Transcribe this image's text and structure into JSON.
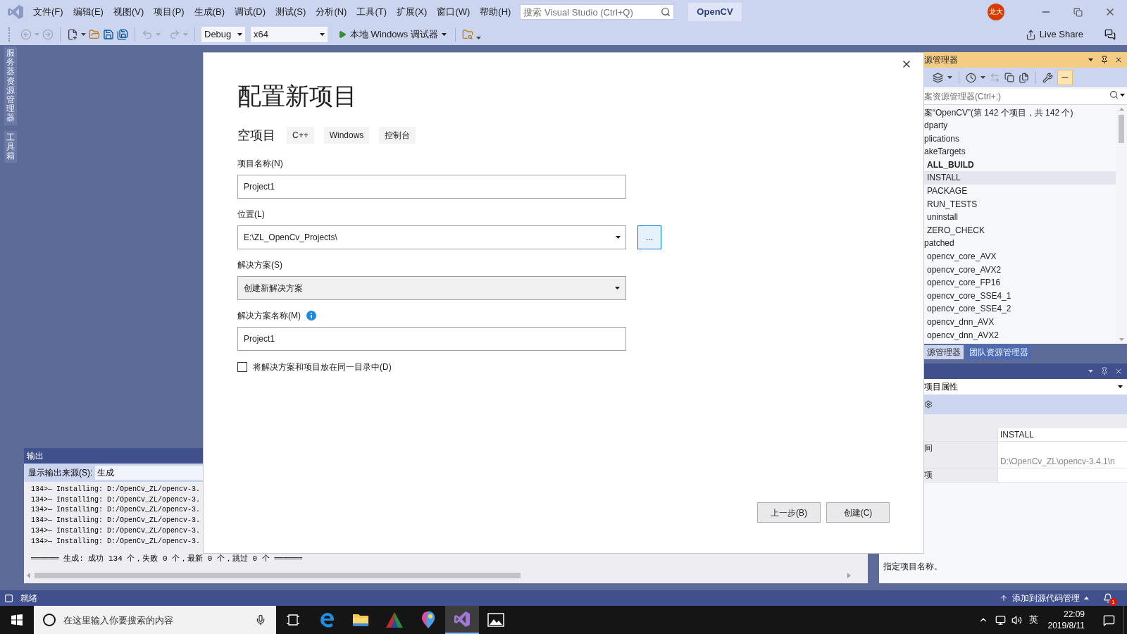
{
  "menu_bar": {
    "menus": [
      "文件(F)",
      "编辑(E)",
      "视图(V)",
      "项目(P)",
      "生成(B)",
      "调试(D)",
      "测试(S)",
      "分析(N)",
      "工具(T)",
      "扩展(X)",
      "窗口(W)",
      "帮助(H)"
    ],
    "search_placeholder": "搜索 Visual Studio (Ctrl+Q)",
    "solution": "OpenCV",
    "avatar": "龙大"
  },
  "toolbar": {
    "configuration": "Debug",
    "platform": "x64",
    "debugger": "本地 Windows 调试器",
    "live_share": "Live Share"
  },
  "side_tabs": [
    "服务器资源管理器",
    "工具箱"
  ],
  "dialog": {
    "title": "配置新项目",
    "template": "空项目",
    "tags": [
      "C++",
      "Windows",
      "控制台"
    ],
    "fields": [
      {
        "kind": "text",
        "label": "项目名称(N)",
        "value": "Project1",
        "info": false
      },
      {
        "kind": "combo",
        "label": "位置(L)",
        "value": "E:\\ZL_OpenCv_Projects\\",
        "browse": "...",
        "info": false
      },
      {
        "kind": "select",
        "label": "解决方案(S)",
        "value": "创建新解决方案",
        "info": false
      },
      {
        "kind": "text",
        "label": "解决方案名称(M)",
        "value": "Project1",
        "info": true
      }
    ],
    "checkbox": {
      "label": "将解决方案和项目放在同一目录中(D)",
      "checked": false
    },
    "buttons": [
      "上一步(B)",
      "创建(C)"
    ]
  },
  "solution_explorer": {
    "title": "源管理器",
    "search_placeholder": "案资源管理器(Ctrl+;)",
    "tree": [
      {
        "label": "案“OpenCV”(第 142 个项目，共 142 个)",
        "selected": false,
        "startup": false,
        "children": [
          {
            "label": "dparty",
            "selected": false,
            "startup": false
          },
          {
            "label": "plications",
            "selected": false,
            "startup": false
          },
          {
            "label": "akeTargets",
            "selected": false,
            "startup": false,
            "children": [
              {
                "label": "ALL_BUILD",
                "selected": false,
                "startup": true
              },
              {
                "label": "INSTALL",
                "selected": true,
                "startup": false
              },
              {
                "label": "PACKAGE",
                "selected": false,
                "startup": false
              },
              {
                "label": "RUN_TESTS",
                "selected": false,
                "startup": false
              },
              {
                "label": "uninstall",
                "selected": false,
                "startup": false
              },
              {
                "label": "ZERO_CHECK",
                "selected": false,
                "startup": false
              }
            ]
          },
          {
            "label": "patched",
            "selected": false,
            "startup": false,
            "children": [
              {
                "label": "opencv_core_AVX",
                "selected": false,
                "startup": false
              },
              {
                "label": "opencv_core_AVX2",
                "selected": false,
                "startup": false
              },
              {
                "label": "opencv_core_FP16",
                "selected": false,
                "startup": false
              },
              {
                "label": "opencv_core_SSE4_1",
                "selected": false,
                "startup": false
              },
              {
                "label": "opencv_core_SSE4_2",
                "selected": false,
                "startup": false
              },
              {
                "label": "opencv_dnn_AVX",
                "selected": false,
                "startup": false
              },
              {
                "label": "opencv_dnn_AVX2",
                "selected": false,
                "startup": false
              }
            ]
          }
        ]
      }
    ],
    "tabs": [
      {
        "label": "源管理器",
        "selected": true
      },
      {
        "label": "团队资源管理器",
        "selected": false
      }
    ]
  },
  "properties": {
    "object": "项目属性",
    "rows": [
      {
        "value": "INSTALL",
        "readonly": false
      },
      {
        "name": "间",
        "readonly": false
      },
      {
        "value": "D:\\OpenCv_ZL\\opencv-3.4.1\\n",
        "readonly": true
      },
      {
        "name": "项",
        "readonly": false
      }
    ],
    "description": "指定项目名称。"
  },
  "output": {
    "title": "输出",
    "source_label": "显示输出来源(S):",
    "source": "生成",
    "lines": [
      "134>— Installing: D:/OpenCv_ZL/opencv-3.",
      "134>— Installing: D:/OpenCv_ZL/opencv-3.",
      "134>— Installing: D:/OpenCv_ZL/opencv-3.",
      "134>— Installing: D:/OpenCv_ZL/opencv-3.",
      "134>— Installing: D:/OpenCv_ZL/opencv-3.",
      "134>— Installing: D:/OpenCv_ZL/opencv-3."
    ],
    "summary": "══════ 生成: 成功 134 个，失败 0 个，最新 0 个，跳过 0 个 ══════"
  },
  "status_bar": {
    "status": "就绪",
    "source_control": "添加到源代码管理",
    "notification_count": "1"
  },
  "taskbar": {
    "search_placeholder": "在这里输入你要搜索的内容",
    "apps": [
      {
        "kind": "task-view",
        "selected": false
      },
      {
        "kind": "browser",
        "selected": false
      },
      {
        "kind": "folder",
        "selected": false
      },
      {
        "kind": "triangle",
        "selected": false
      },
      {
        "kind": "balloon",
        "selected": false
      },
      {
        "kind": "loop",
        "selected": true
      },
      {
        "kind": "image",
        "selected": false
      }
    ],
    "input_method": "英",
    "time": "22:09",
    "date": "2019/8/11"
  }
}
